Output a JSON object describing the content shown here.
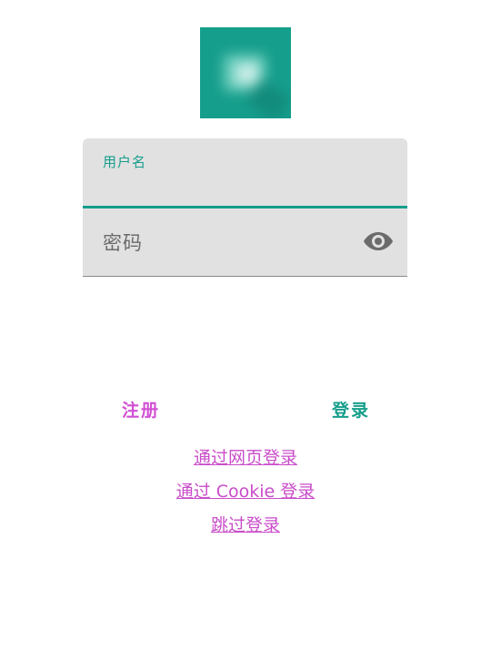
{
  "app": {
    "logo_icon": "app-logo-icon"
  },
  "form": {
    "username_label": "用户名",
    "username_value": "",
    "password_placeholder": "密码",
    "toggle_icon": "eye-icon"
  },
  "actions": {
    "register_label": "注册",
    "login_label": "登录"
  },
  "links": {
    "web_login": "通过网页登录",
    "cookie_login": "通过 Cookie 登录",
    "skip_login": "跳过登录"
  },
  "colors": {
    "accent": "#169e8c",
    "secondary": "#d24fd4",
    "field_bg": "#e1e1e1"
  }
}
